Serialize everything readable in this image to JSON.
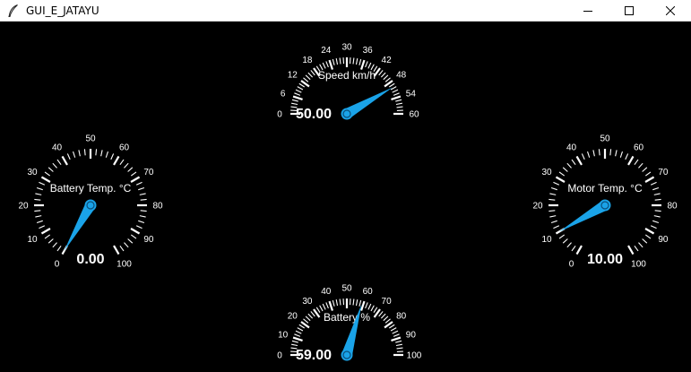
{
  "window": {
    "title": "GUI_E_JATAYU",
    "icon": "feather-icon",
    "minimize": "minimize-icon",
    "maximize": "maximize-icon",
    "close": "close-icon"
  },
  "colors": {
    "background": "#000000",
    "needle": "#1aa3e8",
    "scale": "#ffffff"
  },
  "gauges": [
    {
      "id": "speed",
      "label": "Speed km/h",
      "value": 50.0,
      "display": "50.00",
      "min": 0,
      "max": 60,
      "ticks": [
        "0",
        "6",
        "12",
        "18",
        "24",
        "30",
        "36",
        "42",
        "48",
        "54",
        "60"
      ]
    },
    {
      "id": "battery-temp",
      "label": "Battery Temp. °C",
      "value": 0.0,
      "display": "0.00",
      "min": 0,
      "max": 100,
      "ticks": [
        "0",
        "10",
        "20",
        "30",
        "40",
        "50",
        "60",
        "70",
        "80",
        "90",
        "100"
      ]
    },
    {
      "id": "motor-temp",
      "label": "Motor Temp. °C",
      "value": 10.0,
      "display": "10.00",
      "min": 0,
      "max": 100,
      "ticks": [
        "0",
        "10",
        "20",
        "30",
        "40",
        "50",
        "60",
        "70",
        "80",
        "90",
        "100"
      ]
    },
    {
      "id": "battery",
      "label": "Battery %",
      "value": 59.0,
      "display": "59.00",
      "min": 0,
      "max": 100,
      "ticks": [
        "0",
        "10",
        "20",
        "30",
        "40",
        "50",
        "60",
        "70",
        "80",
        "90",
        "100"
      ]
    }
  ]
}
